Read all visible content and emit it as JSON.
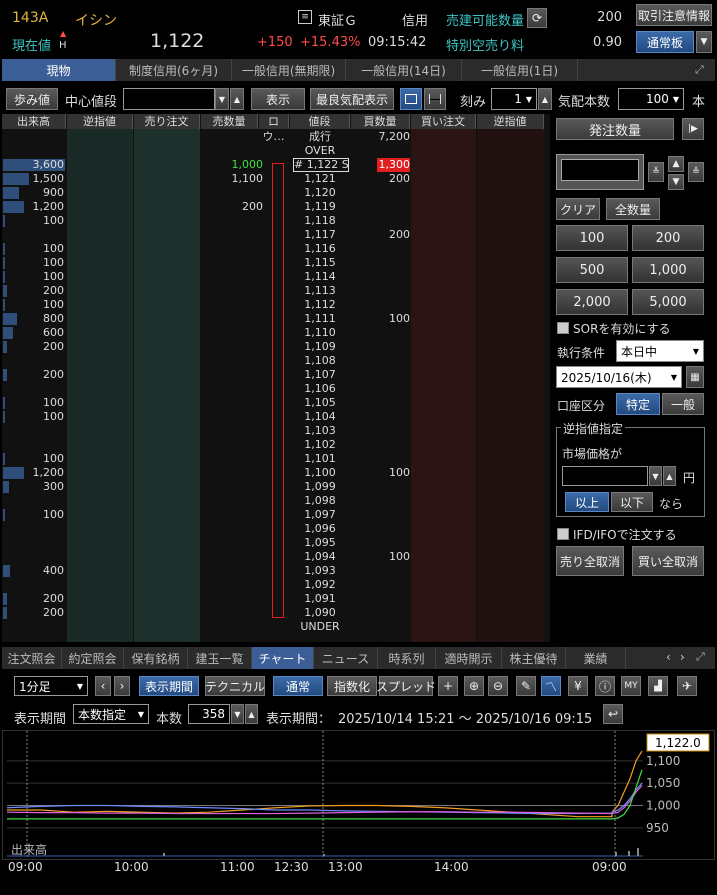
{
  "header": {
    "code": "143A",
    "name": "イシン",
    "market": "東証Ｇ",
    "credit_label": "信用",
    "sell_qty_label": "売建可能数量",
    "sell_qty_value": "200",
    "notice_button": "取引注意情報",
    "current_label": "現在値",
    "high_mark": "H",
    "price": "1,122",
    "change": "+150",
    "change_pct": "+15.43%",
    "time": "09:15:42",
    "short_fee_label": "特別空売り料",
    "short_fee_value": "0.90",
    "board_button": "通常板"
  },
  "tabs": [
    "現物",
    "制度信用(6ヶ月)",
    "一般信用(無期限)",
    "一般信用(14日)",
    "一般信用(1日)"
  ],
  "toolbar": {
    "ayumi": "歩み値",
    "center_label": "中心値段",
    "show": "表示",
    "best_quote": "最良気配表示",
    "tick_label": "刻み",
    "tick_value": "1",
    "quote_count_label": "気配本数",
    "quote_count_value": "100",
    "unit": "本"
  },
  "book": {
    "headers": [
      "出来高",
      "逆指値",
      "売り注文",
      "売数量",
      "ロウ…",
      "値段",
      "買数量",
      "買い注文",
      "逆指値"
    ],
    "rows": [
      {
        "vol": "",
        "sell": "",
        "price": "成行",
        "buy": "7,200",
        "bar": 0
      },
      {
        "vol": "",
        "sell": "",
        "price": "OVER",
        "buy": "",
        "bar": 0
      },
      {
        "vol": "3,600",
        "sell": "1,000",
        "price": "# 1,122 S",
        "buy": "1,300",
        "bar": 62
      },
      {
        "vol": "1,500",
        "sell": "1,100",
        "price": "1,121",
        "buy": "200",
        "bar": 26
      },
      {
        "vol": "900",
        "sell": "",
        "price": "1,120",
        "buy": "",
        "bar": 16
      },
      {
        "vol": "1,200",
        "sell": "200",
        "price": "1,119",
        "buy": "",
        "bar": 21
      },
      {
        "vol": "100",
        "sell": "",
        "price": "1,118",
        "buy": "",
        "bar": 2
      },
      {
        "vol": "",
        "sell": "",
        "price": "1,117",
        "buy": "200",
        "bar": 0
      },
      {
        "vol": "100",
        "sell": "",
        "price": "1,116",
        "buy": "",
        "bar": 2
      },
      {
        "vol": "100",
        "sell": "",
        "price": "1,115",
        "buy": "",
        "bar": 2
      },
      {
        "vol": "100",
        "sell": "",
        "price": "1,114",
        "buy": "",
        "bar": 2
      },
      {
        "vol": "200",
        "sell": "",
        "price": "1,113",
        "buy": "",
        "bar": 4
      },
      {
        "vol": "100",
        "sell": "",
        "price": "1,112",
        "buy": "",
        "bar": 2
      },
      {
        "vol": "800",
        "sell": "",
        "price": "1,111",
        "buy": "100",
        "bar": 14
      },
      {
        "vol": "600",
        "sell": "",
        "price": "1,110",
        "buy": "",
        "bar": 10
      },
      {
        "vol": "200",
        "sell": "",
        "price": "1,109",
        "buy": "",
        "bar": 4
      },
      {
        "vol": "",
        "sell": "",
        "price": "1,108",
        "buy": "",
        "bar": 0
      },
      {
        "vol": "200",
        "sell": "",
        "price": "1,107",
        "buy": "",
        "bar": 4
      },
      {
        "vol": "",
        "sell": "",
        "price": "1,106",
        "buy": "",
        "bar": 0
      },
      {
        "vol": "100",
        "sell": "",
        "price": "1,105",
        "buy": "",
        "bar": 2
      },
      {
        "vol": "100",
        "sell": "",
        "price": "1,104",
        "buy": "",
        "bar": 2
      },
      {
        "vol": "",
        "sell": "",
        "price": "1,103",
        "buy": "",
        "bar": 0
      },
      {
        "vol": "",
        "sell": "",
        "price": "1,102",
        "buy": "",
        "bar": 0
      },
      {
        "vol": "100",
        "sell": "",
        "price": "1,101",
        "buy": "",
        "bar": 2
      },
      {
        "vol": "1,200",
        "sell": "",
        "price": "1,100",
        "buy": "100",
        "bar": 21
      },
      {
        "vol": "300",
        "sell": "",
        "price": "1,099",
        "buy": "",
        "bar": 6
      },
      {
        "vol": "",
        "sell": "",
        "price": "1,098",
        "buy": "",
        "bar": 0
      },
      {
        "vol": "100",
        "sell": "",
        "price": "1,097",
        "buy": "",
        "bar": 2
      },
      {
        "vol": "",
        "sell": "",
        "price": "1,096",
        "buy": "",
        "bar": 0
      },
      {
        "vol": "",
        "sell": "",
        "price": "1,095",
        "buy": "",
        "bar": 0
      },
      {
        "vol": "",
        "sell": "",
        "price": "1,094",
        "buy": "100",
        "bar": 0
      },
      {
        "vol": "400",
        "sell": "",
        "price": "1,093",
        "buy": "",
        "bar": 7
      },
      {
        "vol": "",
        "sell": "",
        "price": "1,092",
        "buy": "",
        "bar": 0
      },
      {
        "vol": "200",
        "sell": "",
        "price": "1,091",
        "buy": "",
        "bar": 4
      },
      {
        "vol": "200",
        "sell": "",
        "price": "1,090",
        "buy": "",
        "bar": 4
      },
      {
        "vol": "",
        "sell": "",
        "price": "UNDER",
        "buy": "",
        "bar": 0
      }
    ]
  },
  "order": {
    "qty_button": "発注数量",
    "clear": "クリア",
    "all_qty": "全数量",
    "quantities": [
      "100",
      "200",
      "500",
      "1,000",
      "2,000",
      "5,000"
    ],
    "sor_label": "SORを有効にする",
    "exec_label": "執行条件",
    "exec_value": "本日中",
    "date_value": "2025/10/16(木)",
    "account_label": "口座区分",
    "account_tokutei": "特定",
    "account_ippan": "一般",
    "stop_label": "逆指値指定",
    "market_price_label": "市場価格が",
    "yen": "円",
    "above": "以上",
    "below": "以下",
    "nara": "なら",
    "ifd_label": "IFD/IFOで注文する",
    "cancel_sell": "売り全取消",
    "cancel_buy": "買い全取消"
  },
  "bottom_tabs": [
    "注文照会",
    "約定照会",
    "保有銘柄",
    "建玉一覧",
    "チャート",
    "ニュース",
    "時系列",
    "適時開示",
    "株主優待",
    "業績"
  ],
  "chart_toolbar": {
    "interval": "1分足",
    "period_btn": "表示期間",
    "technical": "テクニカル",
    "normal": "通常",
    "index": "指数化",
    "spread": "スプレッド",
    "period_label": "表示期間",
    "period_mode": "本数指定",
    "count_label": "本数",
    "count_value": "358",
    "range_label": "表示期間：",
    "range_value": "2025/10/14 15:21 〜 2025/10/16 09:15"
  },
  "chart_data": {
    "type": "line",
    "last_price_label": "1,122.0",
    "y_ticks": [
      "1,100",
      "1,050",
      "1,000",
      "950"
    ],
    "ylim": [
      925,
      1140
    ],
    "volume_label": "出来高",
    "x_ticks": [
      "09:00",
      "10:00",
      "11:00",
      "12:30",
      "13:00",
      "14:00",
      "09:00"
    ],
    "series": [
      {
        "color": "#f0a020",
        "values": [
          990,
          990,
          985,
          987,
          985,
          983,
          985,
          990,
          995,
          999,
          1000,
          1000,
          998,
          995,
          990,
          985,
          980,
          975,
          975,
          985,
          1000,
          1030,
          1060,
          1100,
          1122
        ]
      },
      {
        "color": "#6c8cff",
        "values": [
          995,
          998,
          1000,
          1000,
          998,
          997,
          995,
          993,
          990,
          990,
          988,
          987,
          986,
          985,
          984,
          983,
          982,
          982,
          983,
          985,
          990,
          1000,
          1015,
          1035,
          1050
        ]
      },
      {
        "color": "#e060e0",
        "values": [
          985,
          984,
          984,
          983,
          983,
          982,
          982,
          982,
          982,
          983,
          984,
          985,
          986,
          986,
          985,
          985,
          984,
          983,
          982,
          982,
          985,
          995,
          1010,
          1030,
          1045
        ]
      },
      {
        "color": "#40e040",
        "values": [
          970,
          970,
          970,
          970,
          970,
          970,
          970,
          970,
          970,
          970,
          970,
          970,
          970,
          970,
          970,
          970,
          970,
          970,
          970,
          970,
          972,
          980,
          1000,
          1040,
          1080
        ]
      }
    ]
  },
  "colors": {
    "accent": "#3b5e96",
    "up": "#ff4a4a",
    "sell_highlight": "#e02020"
  }
}
